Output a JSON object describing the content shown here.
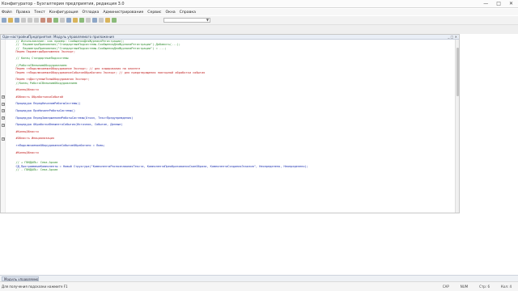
{
  "window": {
    "title": "Конфигуратор - Бухгалтерия предприятия, редакция 3.0",
    "controls": [
      "—",
      "□",
      "✕"
    ]
  },
  "menu": [
    "Файл",
    "Правка",
    "Текст",
    "Конфигурация",
    "Отладка",
    "Администрирование",
    "Сервис",
    "Окна",
    "Справка"
  ],
  "editor": {
    "tab_title": "Одн-настройкиПредприятия: Модуль управляемого приложения",
    "tab_controls": "_ □ ✕",
    "lines": [
      {
        "cls": "cmt",
        "text": "   // Использование: как пример: СообщенияДляЖурналаРегистрации);"
      },
      {
        "cls": "cmt",
        "text": "   //  ПараметрыПриложения(\"СтандартныеПодсистемы.СообщенияДляЖурналаРегистрации\").Добавить(...);"
      },
      {
        "cls": "cmt",
        "text": "   //  ПараметрыПриложения(\"СтандартныеПодсистемы.СообщенияДляЖурналаРегистрации\") = ...;"
      },
      {
        "cls": "kw",
        "text": "   Перем ПараметрыПриложения Экспорт;"
      },
      {
        "cls": "plain",
        "text": ""
      },
      {
        "cls": "cmt",
        "text": "   // Конец СтандартныеПодсистемы"
      },
      {
        "cls": "plain",
        "text": ""
      },
      {
        "cls": "cmt",
        "text": "   //РаботаСВнешнимОборудованием"
      },
      {
        "cls": "kw",
        "text": "   Перем глПодключаемоеОборудование Экспорт; // для кэширования на клиенте"
      },
      {
        "cls": "kw",
        "text": "   Перем глПодключаемоеОборудованиеСобытиеОбработано Экспорт; // для предотвращения повторной обработки события"
      },
      {
        "cls": "plain",
        "text": ""
      },
      {
        "cls": "kw",
        "text": "   Перем глДоступныеТипыОборудования Экспорт;"
      },
      {
        "cls": "cmt",
        "text": "   //Конец РаботаСВнешнимОборудованием"
      },
      {
        "cls": "plain",
        "text": ""
      },
      {
        "cls": "kw",
        "text": "   #КонецОбласти"
      },
      {
        "cls": "plain",
        "text": ""
      },
      {
        "cls": "kw",
        "text": "   #Область ОбработчикиСобытий"
      },
      {
        "cls": "plain",
        "text": ""
      },
      {
        "cls": "pl",
        "text": "   Процедура ПередНачаломРаботыСистемы()"
      },
      {
        "cls": "plain",
        "text": ""
      },
      {
        "cls": "pl",
        "text": "   Процедура ПриНачалеРаботыСистемы()"
      },
      {
        "cls": "plain",
        "text": ""
      },
      {
        "cls": "pl",
        "text": "   Процедура ПередЗавершениемРаботыСистемы(Отказ, ТекстПредупреждения)"
      },
      {
        "cls": "plain",
        "text": ""
      },
      {
        "cls": "pl",
        "text": "   Процедура ОбработкаВнешнегоСобытия(Источник, Событие, Данные)"
      },
      {
        "cls": "plain",
        "text": ""
      },
      {
        "cls": "kw",
        "text": "   #КонецОбласти"
      },
      {
        "cls": "plain",
        "text": ""
      },
      {
        "cls": "kw",
        "text": "   #Область Инициализация"
      },
      {
        "cls": "plain",
        "text": ""
      },
      {
        "cls": "id",
        "text": "   глПодключаемоеОборудованиеСобытиеОбработано = Ложь;"
      },
      {
        "cls": "plain",
        "text": ""
      },
      {
        "cls": "kw",
        "text": "   #КонецОбласти"
      },
      {
        "cls": "plain",
        "text": ""
      },
      {
        "cls": "plain",
        "text": ""
      },
      {
        "cls": "cmt",
        "text": "   // + ГЮНДАЛЬ: Сева-Архив"
      },
      {
        "cls": "id",
        "text": "   СД_ПрограммныеКомпоненты = Новый Структура(\"КомпонентаРаспознаванияТекста, КомпонентаПреобразованияСканОбраза, КомпонентаСозданияЭскизов\", Неопределено, Неопределено);"
      },
      {
        "cls": "cmt",
        "text": "   // - ГЮНДАЛЬ: Сева-Архив"
      }
    ],
    "fold_rows": [
      16,
      18,
      20,
      22,
      24,
      28
    ]
  },
  "taskbar": {
    "active_window": "Модуль управляемого п..."
  },
  "status": {
    "hint": "Для получения подсказки нажмите F1",
    "right": [
      "CAP",
      "NUM",
      "Стр: 6",
      "Кол: 4"
    ]
  }
}
